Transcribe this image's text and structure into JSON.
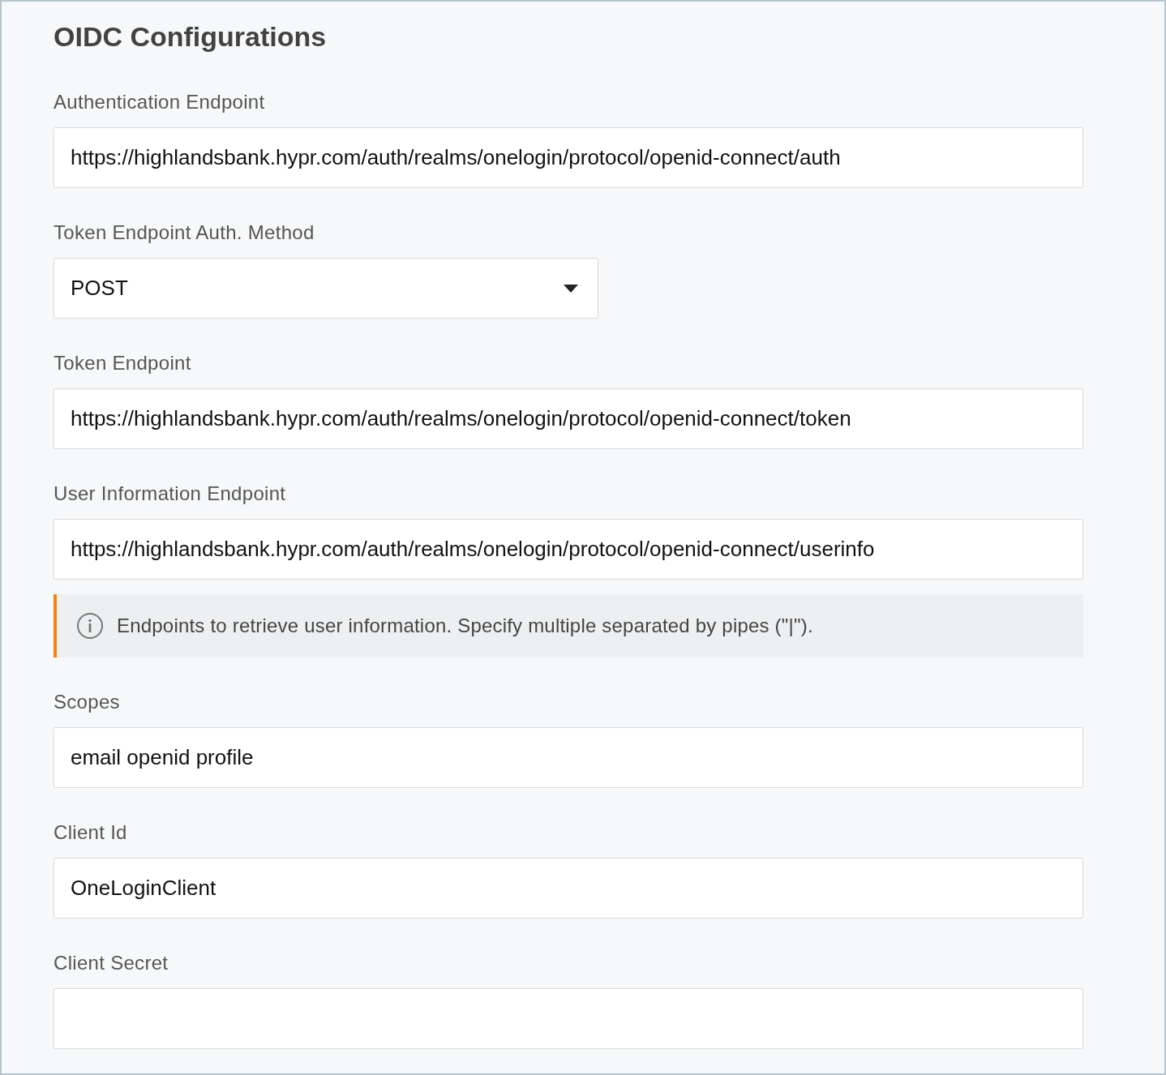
{
  "title": "OIDC Configurations",
  "fields": [
    {
      "kind": "text",
      "label": "Authentication Endpoint",
      "value": "https://highlandsbank.hypr.com/auth/realms/onelogin/protocol/openid-connect/auth"
    },
    {
      "kind": "select",
      "label": "Token Endpoint Auth. Method",
      "value": "POST"
    },
    {
      "kind": "text",
      "label": "Token Endpoint",
      "value": "https://highlandsbank.hypr.com/auth/realms/onelogin/protocol/openid-connect/token"
    },
    {
      "kind": "text",
      "label": "User Information Endpoint",
      "value": "https://highlandsbank.hypr.com/auth/realms/onelogin/protocol/openid-connect/userinfo"
    },
    {
      "kind": "info",
      "text": "Endpoints to retrieve user information. Specify multiple separated by pipes (\"|\")."
    },
    {
      "kind": "text",
      "label": "Scopes",
      "value": "email openid profile"
    },
    {
      "kind": "text",
      "label": "Client Id",
      "value": "OneLoginClient"
    },
    {
      "kind": "text",
      "label": "Client Secret"
    }
  ]
}
